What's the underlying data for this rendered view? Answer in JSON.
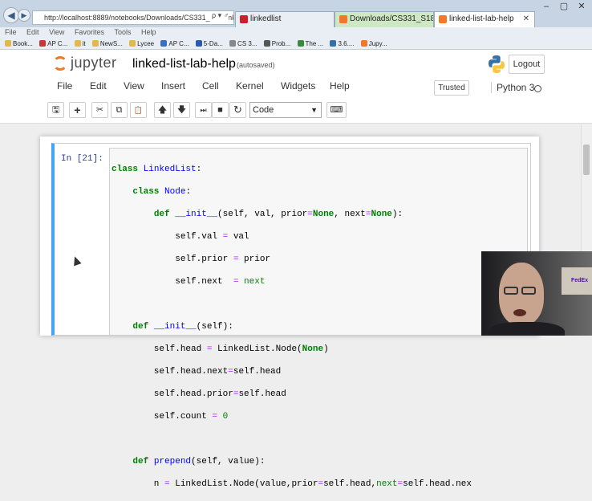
{
  "browser": {
    "address": "http://localhost:8889/notebooks/Downloads/CS331_S18/linked-",
    "address_search_glyph": "ρ ▾ ♂",
    "tabs": [
      {
        "label": "linkedlist",
        "icon_color": "#cc1f2b"
      },
      {
        "label": "Downloads/CS331_S18/",
        "icon_color": "#f37726"
      },
      {
        "label": "linked-list-lab-help",
        "icon_color": "#f37726"
      }
    ],
    "menu": [
      "File",
      "Edit",
      "View",
      "Favorites",
      "Tools",
      "Help"
    ],
    "favorites": [
      "Book...",
      "AP C...",
      "it",
      "NewS...",
      "Lycee",
      "AP C...",
      "5-Da...",
      "CS 3...",
      "Prob...",
      "The ...",
      "3.6....",
      "Jupy..."
    ],
    "window_controls": [
      "–",
      "▢",
      "✕"
    ]
  },
  "jupyter": {
    "logo_text": "jupyter",
    "notebook_title": "linked-list-lab-help",
    "save_status": "(autosaved)",
    "logout_label": "Logout",
    "menu": [
      "File",
      "Edit",
      "View",
      "Insert",
      "Cell",
      "Kernel",
      "Widgets",
      "Help"
    ],
    "trusted_label": "Trusted",
    "kernel_name": "Python 3",
    "toolbar": [
      {
        "name": "save-icon",
        "glyph": "🖫"
      },
      {
        "name": "plus-icon",
        "glyph": "+"
      },
      {
        "name": "cut-icon",
        "glyph": "✂"
      },
      {
        "name": "copy-icon",
        "glyph": "⧉"
      },
      {
        "name": "paste-icon",
        "glyph": "📋"
      },
      {
        "name": "arrow-up-icon",
        "glyph": "🡅"
      },
      {
        "name": "arrow-down-icon",
        "glyph": "🡇"
      },
      {
        "name": "step-forward-icon",
        "glyph": "⏭"
      },
      {
        "name": "stop-icon",
        "glyph": "■"
      },
      {
        "name": "refresh-icon",
        "glyph": "↻"
      }
    ],
    "cell_type": "Code",
    "keyboard_glyph": "⌨"
  },
  "cell": {
    "prompt": "In [21]:",
    "code_lines": [
      "class LinkedList:",
      "    class Node:",
      "        def __init__(self, val, prior=None, next=None):",
      "            self.val = val",
      "            self.prior = prior",
      "            self.next  = next",
      "",
      "    def __init__(self):",
      "        self.head = LinkedList.Node(None)",
      "        self.head.next=self.head",
      "        self.head.prior=self.head",
      "        self.count = 0",
      "",
      "    def prepend(self, value):",
      "        n = LinkedList.Node(value,prior=self.head,next=self.head.nex"
    ]
  },
  "webcam": {
    "label": "FedEx"
  },
  "colors": {
    "accent": "#42a5f5",
    "jupyter_orange": "#f37726",
    "keyword": "#008000",
    "prompt": "#303f9f"
  }
}
